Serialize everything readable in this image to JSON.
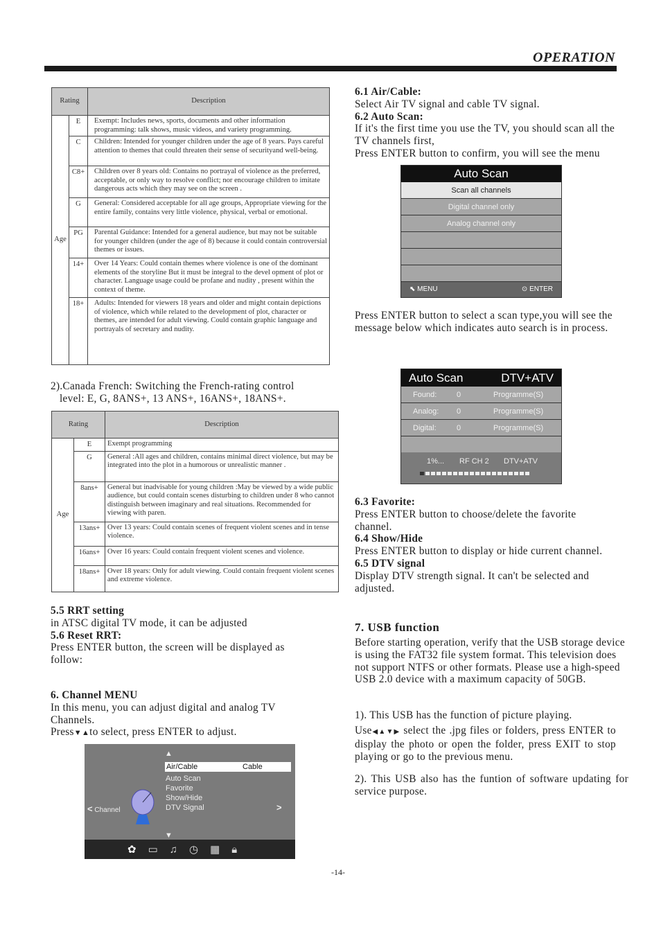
{
  "header": {
    "title": "OPERATION"
  },
  "us_table": {
    "headers": {
      "rating": "Rating",
      "description": "Description"
    },
    "group": "Age",
    "rows": [
      {
        "rating": "E",
        "description": "Exempt: Includes news, sports, documents and other information programming: talk shows, music videos, and variety programming."
      },
      {
        "rating": "C",
        "description": "Children: Intended for younger children under the age of 8 years. Pays careful attention to themes that could threaten their sense of securityand well-being."
      },
      {
        "rating": "C8+",
        "description": "Children over 8 years old: Contains no portrayal of violence as the preferred, acceptable, or only way to resolve conflict; nor encourage children to imitate dangerous acts which they may see on the screen ."
      },
      {
        "rating": "G",
        "description": "General: Considered acceptable for all age groups, Appropriate viewing for the entire family, contains very little violence, physical, verbal or emotional."
      },
      {
        "rating": "PG",
        "description": "Parental Guidance: Intended for a general audience, but may not be suitable for younger children (under the age of 8) because it could contain controversial themes or issues."
      },
      {
        "rating": "14+",
        "description": "Over 14 Years: Could contain themes where violence is one of the dominant elements of the storyline But it must be integral to the devel opment of plot or character. Language usage could be profane and nudity , present within the context of theme."
      },
      {
        "rating": "18+",
        "description": "Adults: Intended for viewers 18 years and older and might contain depictions of  violence, which while related to the development of plot,  character or themes, are intended for adult  viewing. Could contain graphic language and portrayals of secretary and nudity."
      }
    ]
  },
  "canada_french_intro": "2).Canada French: Switching the French-rating control level: E, G, 8ANS+, 13 ANS+, 16ANS+, 18ANS+.",
  "fr_table": {
    "headers": {
      "rating": "Rating",
      "description": "Description"
    },
    "group": "Age",
    "rows": [
      {
        "rating": "E",
        "description": "Exempt programming"
      },
      {
        "rating": "G",
        "description": "General :All ages and children, contains minimal direct violence, but may be integrated into the plot in a humorous or unrealistic manner ."
      },
      {
        "rating": "8ans+",
        "description": "General but inadvisable for young children :May be viewed by a wide public audience, but could contain scenes disturbing to children under 8 who cannot distinguish between imaginary and real situations. Recommended for viewing with paren."
      },
      {
        "rating": "13ans+",
        "description": "Over 13 years: Could contain scenes of frequent violent scenes and in tense violence."
      },
      {
        "rating": "16ans+",
        "description": "Over 16 years: Could contain frequent violent scenes and violence."
      },
      {
        "rating": "18ans+",
        "description": "Over 18 years: Only for adult viewing. Could contain frequent violent  scenes and extreme violence."
      }
    ]
  },
  "left": {
    "rrt_heading": "5.5 RRT setting",
    "rrt_text": "in ATSC digital TV mode, it can be adjusted",
    "reset_heading": "5.6 Reset RRT:",
    "reset_text": "Press ENTER button, the screen will be displayed as follow:",
    "channel_heading": "6. Channel MENU",
    "channel_text": "In this menu, you can adjust digital and analog TV Channels.",
    "press_prefix": "Press",
    "press_suffix": "to select, press ENTER to adjust."
  },
  "channel_menu": {
    "side_label": "Channel",
    "items": [
      "Air/Cable",
      "Auto Scan",
      "Favorite",
      "Show/Hide",
      "DTV Signal"
    ],
    "selected_value": "Cable",
    "icons": [
      "settings-icon",
      "picture-icon",
      "sound-icon",
      "time-icon",
      "option-icon",
      "lock-icon"
    ]
  },
  "right": {
    "air_heading": "6.1 Air/Cable:",
    "air_text": "Select Air TV signal and cable TV signal.",
    "scan_heading": "6.2 Auto Scan:",
    "scan_text": "If it's the first time you use the TV, you should scan all the TV channels first,",
    "scan_text2": "Press ENTER button to confirm, you will see the menu",
    "scan_type_text": "Press ENTER button to select a scan type,you will see the message below which indicates auto search is in process.",
    "fav_heading": "6.3 Favorite:",
    "fav_text": "Press ENTER button to choose/delete the favorite channel.",
    "show_heading": "6.4 Show/Hide",
    "show_text": "Press ENTER button to display or hide current channel.",
    "dtv_heading": "6.5 DTV signal",
    "dtv_text": "Display DTV strength signal. It can't be selected and adjusted.",
    "usb_heading": "7. USB function",
    "usb_text": "Before starting operation, verify that the USB storage device is using the FAT32 file system format. This television does not support NTFS or other formats. Please use a high-speed USB 2.0  device with a maximum capacity of 50GB.",
    "usb_1": "1). This USB has the function of picture playing.",
    "usb_use_prefix": "Use",
    "usb_use_text": "select the .jpg files or folders, press ENTER to display the photo or open the folder, press EXIT to stop playing or go to the previous menu.",
    "usb_2": "2). This USB also has the funtion of software updating for service purpose."
  },
  "auto_scan_menu": {
    "title": "Auto Scan",
    "options": [
      "Scan all channels",
      "Digital channel only",
      "Analog channel only",
      "",
      "",
      ""
    ],
    "selected_index": 0,
    "footer_menu": "MENU",
    "footer_enter": "ENTER"
  },
  "auto_scan_progress": {
    "title": "Auto Scan",
    "mode": "DTV+ATV",
    "rows": [
      {
        "label": "Found:",
        "count": "0",
        "unit": "Programme(S)"
      },
      {
        "label": "Analog:",
        "count": "0",
        "unit": "Programme(S)"
      },
      {
        "label": "Digital:",
        "count": "0",
        "unit": "Programme(S)"
      }
    ],
    "percent_text": "1%...",
    "rf_channel": "RF CH 2",
    "band": "DTV+ATV",
    "progress_percent": 1
  },
  "page_number": "-14-"
}
